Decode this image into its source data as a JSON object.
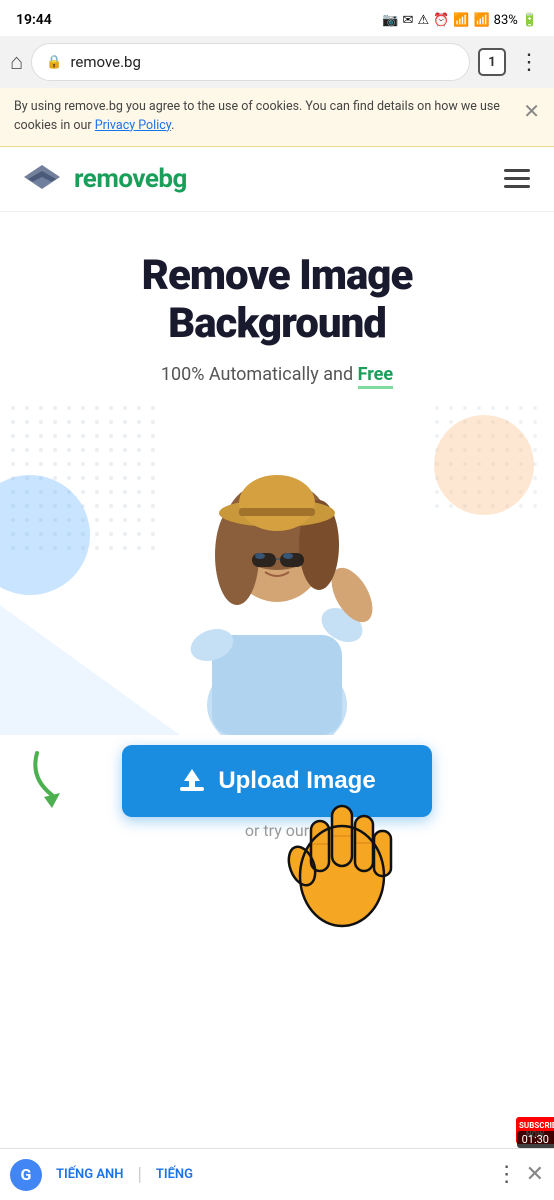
{
  "status_bar": {
    "time": "19:44",
    "battery": "83%",
    "icons": [
      "camera",
      "email",
      "warning",
      "alarm",
      "wifi",
      "signal"
    ]
  },
  "browser": {
    "url": "remove.bg",
    "tab_count": "1",
    "home_icon": "⌂",
    "lock_icon": "🔒",
    "menu_icon": "⋮"
  },
  "cookie_banner": {
    "text": "By using remove.bg you agree to the use of cookies. You can find details on how we use cookies in our ",
    "link_text": "Privacy Policy",
    "close_icon": "✕"
  },
  "site_header": {
    "logo_text_dark": "remove",
    "logo_text_green": "bg",
    "menu_label": "Menu"
  },
  "hero": {
    "title_line1": "Remove Image",
    "title_line2": "Background",
    "subtitle_normal": "100% Automatically and ",
    "subtitle_bold": "Free"
  },
  "upload": {
    "button_label": "Upload Image",
    "or_text": "or try our"
  },
  "translator_bar": {
    "g_label": "G",
    "lang1": "TIẾNG ANH",
    "lang2": "TIẾNG",
    "separator": "|",
    "menu_icon": "⋮",
    "close_icon": "✕"
  },
  "subscribe_badge": {
    "text": "SUBSCRIBE\nNOW",
    "timer": "01:30"
  },
  "colors": {
    "upload_btn": "#1a8de0",
    "logo_green": "#1a9f5a",
    "underline_green": "#7cdc9e",
    "arrow_green": "#4caf50",
    "hero_title": "#1a1a2e"
  }
}
